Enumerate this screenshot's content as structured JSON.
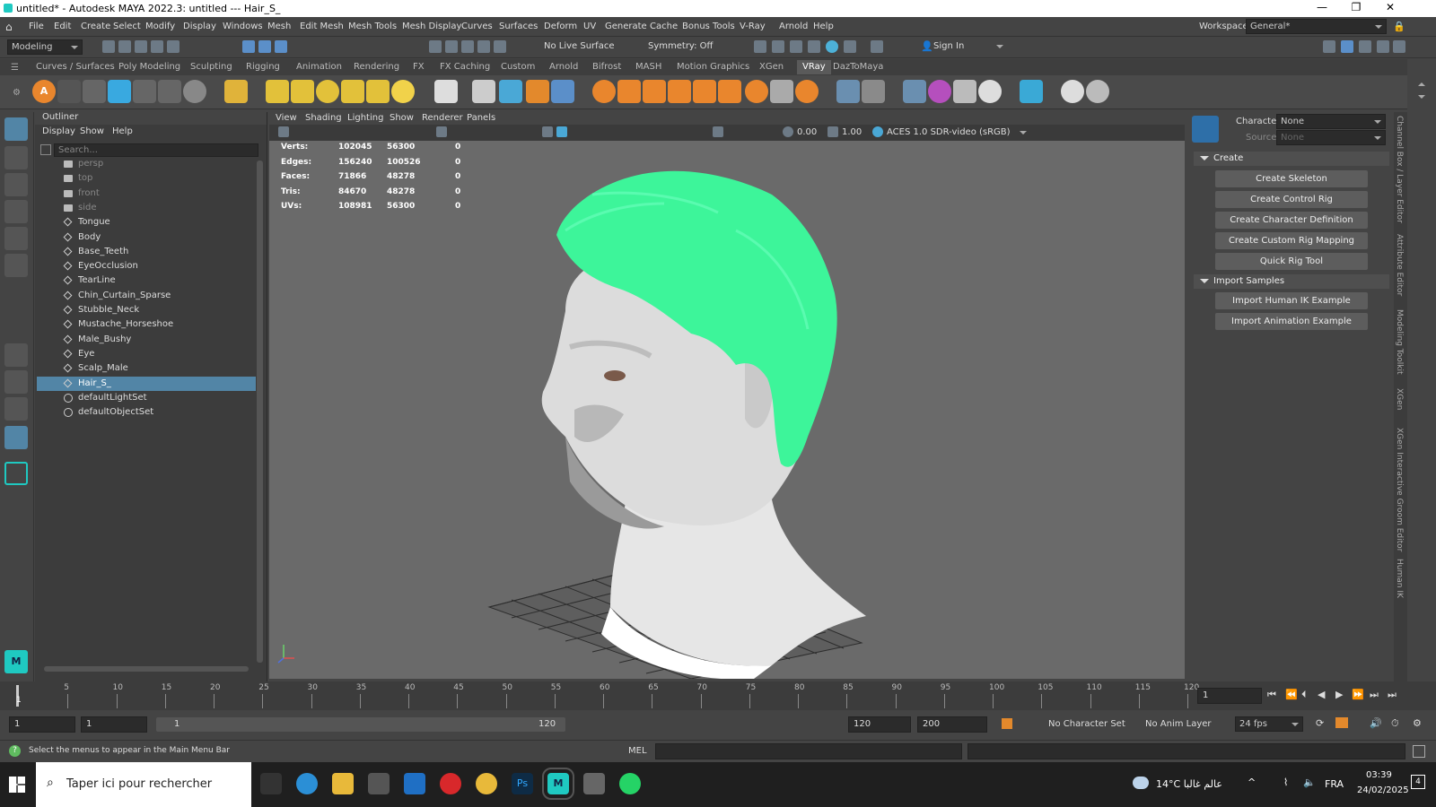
{
  "window": {
    "title": "untitled* - Autodesk MAYA 2022.3: untitled   ---   Hair_S_"
  },
  "menu": [
    "File",
    "Edit",
    "Create",
    "Select",
    "Modify",
    "Display",
    "Windows",
    "Mesh",
    "Edit Mesh",
    "Mesh Tools",
    "Mesh Display",
    "Curves",
    "Surfaces",
    "Deform",
    "UV",
    "Generate",
    "Cache",
    "Bonus Tools",
    "V-Ray",
    "Arnold",
    "Help"
  ],
  "workspace": {
    "label": "Workspace:",
    "value": "General*"
  },
  "status": {
    "mode": "Modeling",
    "live_surface": "No Live Surface",
    "symmetry": "Symmetry: Off",
    "sign_in": "Sign In"
  },
  "shelf_tabs": [
    "Curves / Surfaces",
    "Poly Modeling",
    "Sculpting",
    "Rigging",
    "Animation",
    "Rendering",
    "FX",
    "FX Caching",
    "Custom",
    "Arnold",
    "Bifrost",
    "MASH",
    "Motion Graphics",
    "XGen",
    "VRay",
    "DazToMaya"
  ],
  "shelf_active": "VRay",
  "outliner": {
    "title": "Outliner",
    "menu": [
      "Display",
      "Show",
      "Help"
    ],
    "search_placeholder": "Search...",
    "items": [
      {
        "label": "persp",
        "type": "camera",
        "dim": true
      },
      {
        "label": "top",
        "type": "camera",
        "dim": true
      },
      {
        "label": "front",
        "type": "camera",
        "dim": true
      },
      {
        "label": "side",
        "type": "camera",
        "dim": true
      },
      {
        "label": "Tongue",
        "type": "mesh"
      },
      {
        "label": "Body",
        "type": "mesh"
      },
      {
        "label": "Base_Teeth",
        "type": "mesh"
      },
      {
        "label": "EyeOcclusion",
        "type": "mesh"
      },
      {
        "label": "TearLine",
        "type": "mesh"
      },
      {
        "label": "Chin_Curtain_Sparse",
        "type": "mesh"
      },
      {
        "label": "Stubble_Neck",
        "type": "mesh"
      },
      {
        "label": "Mustache_Horseshoe",
        "type": "mesh"
      },
      {
        "label": "Male_Bushy",
        "type": "mesh"
      },
      {
        "label": "Eye",
        "type": "mesh"
      },
      {
        "label": "Scalp_Male",
        "type": "mesh"
      },
      {
        "label": "Hair_S_",
        "type": "mesh",
        "selected": true
      },
      {
        "label": "defaultLightSet",
        "type": "set"
      },
      {
        "label": "defaultObjectSet",
        "type": "set"
      }
    ]
  },
  "viewport": {
    "menu": [
      "View",
      "Shading",
      "Lighting",
      "Show",
      "Renderer",
      "Panels"
    ],
    "exposure": "0.00",
    "gamma": "1.00",
    "colorspace": "ACES 1.0 SDR-video (sRGB)",
    "hud": [
      {
        "label": "Verts:",
        "a": "102045",
        "b": "56300",
        "c": "0"
      },
      {
        "label": "Edges:",
        "a": "156240",
        "b": "100526",
        "c": "0"
      },
      {
        "label": "Faces:",
        "a": "71866",
        "b": "48278",
        "c": "0"
      },
      {
        "label": "Tris:",
        "a": "84670",
        "b": "48278",
        "c": "0"
      },
      {
        "label": "UVs:",
        "a": "108981",
        "b": "56300",
        "c": "0"
      }
    ]
  },
  "hik": {
    "character_label": "Character:",
    "character_value": "None",
    "source_label": "Source:",
    "source_value": "None",
    "create_title": "Create",
    "create_buttons": [
      "Create Skeleton",
      "Create Control Rig",
      "Create Character Definition",
      "Create Custom Rig Mapping",
      "Quick Rig Tool"
    ],
    "import_title": "Import Samples",
    "import_buttons": [
      "Import Human IK Example",
      "Import Animation Example"
    ]
  },
  "side_tabs": [
    "Channel Box / Layer Editor",
    "Attribute Editor",
    "Modeling Toolkit",
    "XGen",
    "XGen Interactive Groom Editor",
    "Human IK"
  ],
  "timeline": {
    "ticks": [
      "5",
      "10",
      "15",
      "20",
      "25",
      "30",
      "35",
      "40",
      "45",
      "50",
      "55",
      "60",
      "65",
      "70",
      "75",
      "80",
      "85",
      "90",
      "95",
      "100",
      "105",
      "110",
      "115",
      "120"
    ],
    "current": "1",
    "frame_field": "1"
  },
  "range": {
    "start": "1",
    "inner_start": "1",
    "slider_start": "1",
    "slider_end": "120",
    "end": "120",
    "total_end": "200",
    "character_set": "No Character Set",
    "anim_layer": "No Anim Layer",
    "fps": "24 fps"
  },
  "cmd": {
    "help": "Select the menus to appear in the Main Menu Bar",
    "lang": "MEL"
  },
  "taskbar": {
    "search": "Taper ici pour rechercher",
    "weather": "14°C  عالم غالبا",
    "lang": "FRA",
    "time": "03:39",
    "date": "24/02/2025",
    "notif": "4"
  },
  "colors": {
    "hair": "#3df59a",
    "selection": "#5285a6",
    "maya_logo": "#1fc9c1"
  }
}
